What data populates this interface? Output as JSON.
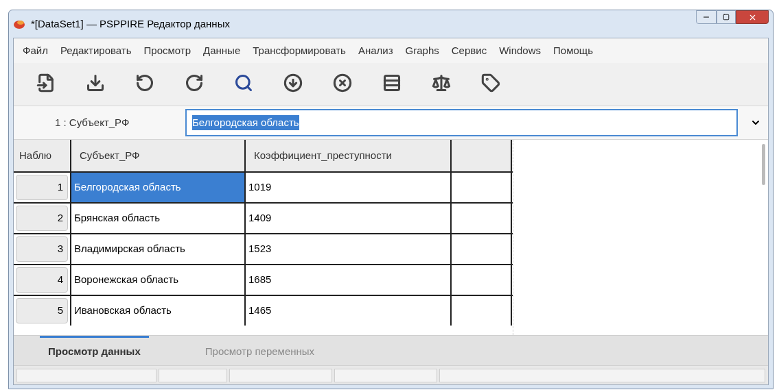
{
  "window": {
    "title": "*[DataSet1] — PSPPIRE Редактор данных"
  },
  "menu": [
    "Файл",
    "Редактировать",
    "Просмотр",
    "Данные",
    "Трансформировать",
    "Анализ",
    "Graphs",
    "Сервис",
    "Windows",
    "Помощь"
  ],
  "cell_ref": {
    "label": "1 : Субъект_РФ",
    "value": "Белгородская область"
  },
  "table": {
    "row_header": "Наблю",
    "columns": [
      "Субъект_РФ",
      "Коэффициент_преступности"
    ],
    "rows": [
      {
        "number": "1",
        "cells": [
          {
            "text": "Белгородская область",
            "selected": true
          },
          {
            "text": "1019",
            "selected": false
          }
        ]
      },
      {
        "number": "2",
        "cells": [
          {
            "text": "Брянская область",
            "selected": false
          },
          {
            "text": "1409",
            "selected": false
          }
        ]
      },
      {
        "number": "3",
        "cells": [
          {
            "text": "Владимирская область",
            "selected": false
          },
          {
            "text": "1523",
            "selected": false
          }
        ]
      },
      {
        "number": "4",
        "cells": [
          {
            "text": "Воронежская область",
            "selected": false
          },
          {
            "text": "1685",
            "selected": false
          }
        ]
      },
      {
        "number": "5",
        "cells": [
          {
            "text": "Ивановская область",
            "selected": false
          },
          {
            "text": "1465",
            "selected": false
          }
        ]
      }
    ]
  },
  "tabs": [
    {
      "label": "Просмотр данных",
      "selected": true
    },
    {
      "label": "Просмотр переменных",
      "selected": false
    }
  ]
}
